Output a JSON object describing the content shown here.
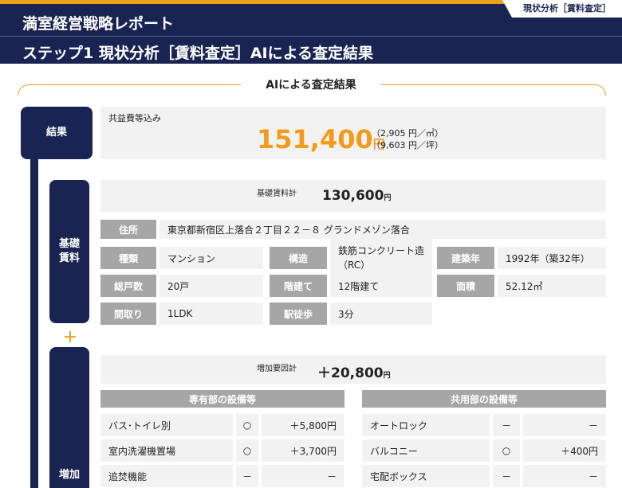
{
  "header": {
    "title": "満室経営戦略レポート",
    "subtitle": "ステップ1 現状分析［賃料査定］AIによる査定結果",
    "tag": "現状分析［賃料査定］"
  },
  "section_title": "AIによる査定結果",
  "result": {
    "label": "結果",
    "caption": "共益費等込み",
    "amount": "151,400",
    "unit": "円",
    "per_sqm": "（2,905 円／㎡）",
    "per_tsubo": "（9,603 円／坪）"
  },
  "base": {
    "label_line1": "基礎",
    "label_line2": "賃料",
    "caption": "基礎賃料計",
    "amount": "130,600",
    "unit": "円",
    "address_label": "住所",
    "address": "東京都新宿区上落合２丁目２２－８ グランドメゾン落合",
    "rows": [
      [
        {
          "label": "種類",
          "value": "マンション"
        },
        {
          "label": "構造",
          "value": "鉄筋コンクリート造",
          "value2": "（RC）"
        },
        {
          "label": "建築年",
          "value": "1992年（築32年）"
        }
      ],
      [
        {
          "label": "総戸数",
          "value": "20戸"
        },
        {
          "label": "階建て",
          "value": "12階建て"
        },
        {
          "label": "面積",
          "value": "52.12㎡"
        }
      ],
      [
        {
          "label": "間取り",
          "value": "1LDK"
        },
        {
          "label": "駅徒歩",
          "value": "3分"
        }
      ]
    ]
  },
  "plus_sign": "＋",
  "increase": {
    "label": "増加",
    "caption": "増加要因計",
    "amount": "＋20,800",
    "unit": "円",
    "private_header": "専有部の設備等",
    "common_header": "共用部の設備等",
    "private_items": [
      {
        "name": "バス･トイレ別",
        "mark": "○",
        "value": "＋5,800円"
      },
      {
        "name": "室内洗濯機置場",
        "mark": "○",
        "value": "＋3,700円"
      },
      {
        "name": "追焚機能",
        "mark": "－",
        "value": "－"
      }
    ],
    "common_items": [
      {
        "name": "オートロック",
        "mark": "－",
        "value": "－"
      },
      {
        "name": "バルコニー",
        "mark": "○",
        "value": "＋400円"
      },
      {
        "name": "宅配ボックス",
        "mark": "－",
        "value": "－"
      }
    ]
  }
}
